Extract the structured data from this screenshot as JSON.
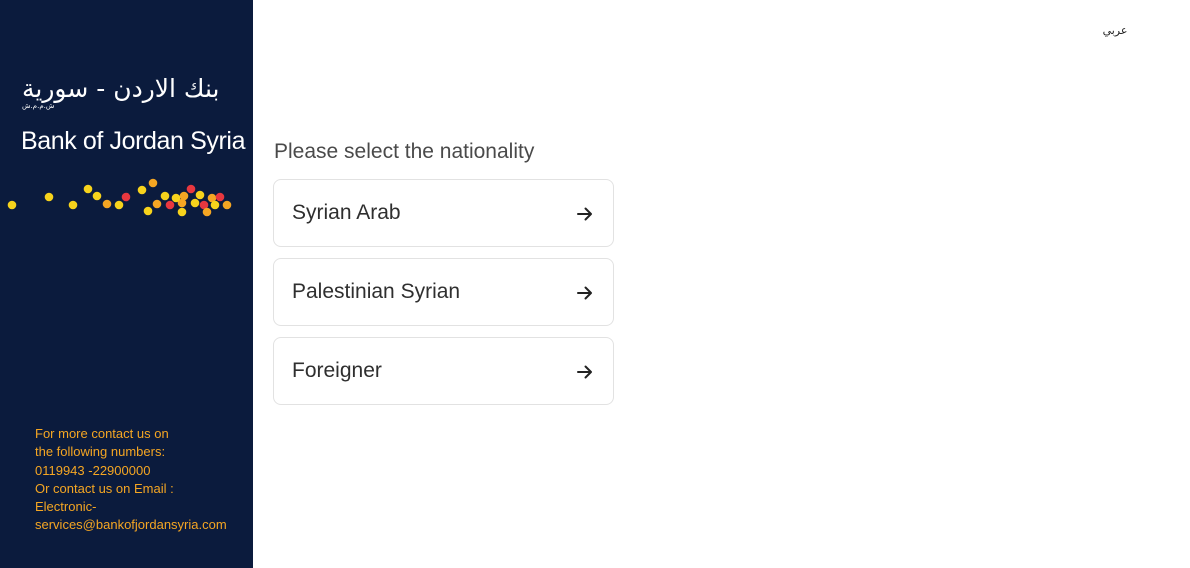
{
  "sidebar": {
    "logo_arabic": "بنك الاردن - سورية",
    "logo_arabic_sub": "ش.م.م.ش",
    "logo_english": "Bank of Jordan Syria",
    "dot_colors": [
      "#f7d31c",
      "#f5a623",
      "#e8373f"
    ],
    "contact": {
      "line1": "For more contact us on",
      "line2": "the following numbers:",
      "line3": "0119943 -22900000",
      "line4": "Or contact us on Email :",
      "line5": "Electronic-",
      "line6": "services@bankofjordansyria.com"
    }
  },
  "header": {
    "language_link": "عربي"
  },
  "main": {
    "prompt": "Please select the nationality",
    "options": [
      {
        "label": "Syrian Arab",
        "icon": "arrow-right-icon"
      },
      {
        "label": "Palestinian Syrian",
        "icon": "arrow-right-icon"
      },
      {
        "label": "Foreigner",
        "icon": "arrow-right-icon"
      }
    ]
  },
  "colors": {
    "sidebar_bg": "#0b1b3d",
    "contact_text": "#f5a623",
    "option_border": "#e2e2e2"
  }
}
